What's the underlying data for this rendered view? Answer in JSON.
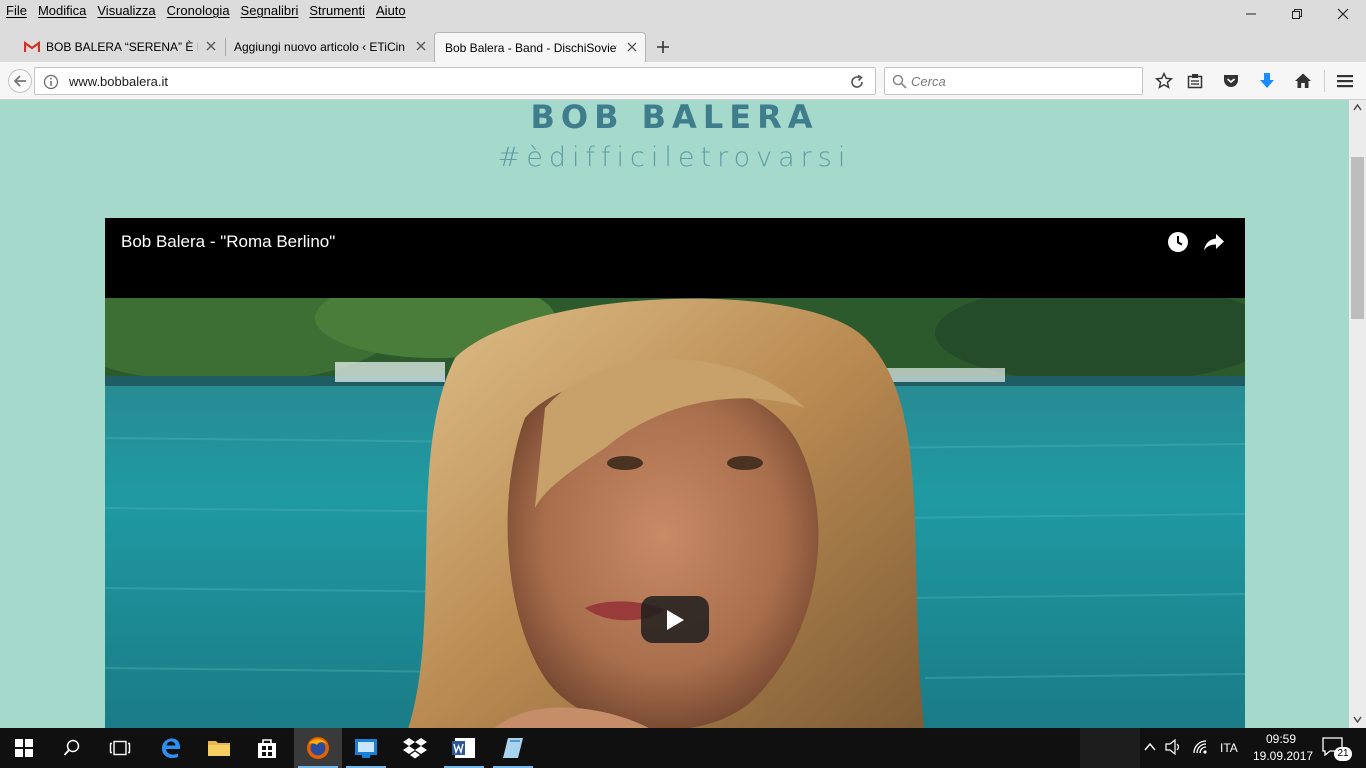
{
  "menu": [
    "File",
    "Modifica",
    "Visualizza",
    "Cronologia",
    "Segnalibri",
    "Strumenti",
    "Aiuto"
  ],
  "tabs": [
    {
      "label": "BOB BALERA “SERENA” È IL N",
      "icon": "gmail-icon",
      "active": false
    },
    {
      "label": "Aggiungi nuovo articolo ‹ ETiCin",
      "active": false
    },
    {
      "label": "Bob Balera - Band - DischiSoviet",
      "active": true
    }
  ],
  "url": "www.bobbalera.it",
  "search": {
    "placeholder": "Cerca"
  },
  "page": {
    "brand": "BOB BALERA",
    "tagline": "#èdifficiletrovarsi",
    "video_title": "Bob Balera - \"Roma Berlino\""
  },
  "tray": {
    "lang": "ITA",
    "time": "09:59",
    "date": "19.09.2017",
    "notifications": "21"
  },
  "colors": {
    "page_bg": "#a4d9cb",
    "brand": "#3f7d8c",
    "download_arrow": "#1a8cff"
  }
}
